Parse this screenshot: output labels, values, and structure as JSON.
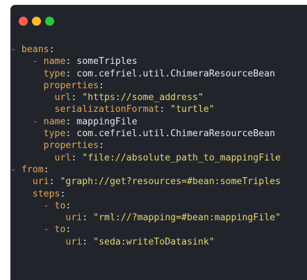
{
  "window": {
    "buttons": [
      {
        "name": "close",
        "color": "#ff5f57"
      },
      {
        "name": "minimize",
        "color": "#febc2e"
      },
      {
        "name": "maximize",
        "color": "#28c840"
      }
    ]
  },
  "colors": {
    "background": "#21252b",
    "dash": "#e06c75",
    "key": "#e5a454",
    "string": "#e8d36e",
    "plain": "#e6e6e6"
  },
  "code_lines": [
    [
      {
        "t": "d",
        "v": "- "
      },
      {
        "t": "k",
        "v": "beans"
      },
      {
        "t": "v",
        "v": ":"
      }
    ],
    [
      {
        "t": "v",
        "v": "    "
      },
      {
        "t": "d",
        "v": "- "
      },
      {
        "t": "k",
        "v": "name"
      },
      {
        "t": "v",
        "v": ": someTriples"
      }
    ],
    [
      {
        "t": "v",
        "v": "      "
      },
      {
        "t": "k",
        "v": "type"
      },
      {
        "t": "v",
        "v": ": com.cefriel.util.ChimeraResourceBean"
      }
    ],
    [
      {
        "t": "v",
        "v": "      "
      },
      {
        "t": "k",
        "v": "properties"
      },
      {
        "t": "v",
        "v": ":"
      }
    ],
    [
      {
        "t": "v",
        "v": "        "
      },
      {
        "t": "k",
        "v": "url"
      },
      {
        "t": "v",
        "v": ": "
      },
      {
        "t": "s",
        "v": "\"https://some_address\""
      }
    ],
    [
      {
        "t": "v",
        "v": "        "
      },
      {
        "t": "k",
        "v": "serializationFormat"
      },
      {
        "t": "v",
        "v": ": "
      },
      {
        "t": "s",
        "v": "\"turtle\""
      }
    ],
    [
      {
        "t": "v",
        "v": "    "
      },
      {
        "t": "d",
        "v": "- "
      },
      {
        "t": "k",
        "v": "name"
      },
      {
        "t": "v",
        "v": ": mappingFile"
      }
    ],
    [
      {
        "t": "v",
        "v": "      "
      },
      {
        "t": "k",
        "v": "type"
      },
      {
        "t": "v",
        "v": ": com.cefriel.util.ChimeraResourceBean"
      }
    ],
    [
      {
        "t": "v",
        "v": "      "
      },
      {
        "t": "k",
        "v": "properties"
      },
      {
        "t": "v",
        "v": ":"
      }
    ],
    [
      {
        "t": "v",
        "v": "        "
      },
      {
        "t": "k",
        "v": "url"
      },
      {
        "t": "v",
        "v": ": "
      },
      {
        "t": "s",
        "v": "\"file://absolute_path_to_mappingFile"
      }
    ],
    [
      {
        "t": "d",
        "v": "- "
      },
      {
        "t": "k",
        "v": "from"
      },
      {
        "t": "v",
        "v": ":"
      }
    ],
    [
      {
        "t": "v",
        "v": "    "
      },
      {
        "t": "k",
        "v": "uri"
      },
      {
        "t": "v",
        "v": ": "
      },
      {
        "t": "s",
        "v": "\"graph://get?resources=#bean:someTriples"
      }
    ],
    [
      {
        "t": "v",
        "v": "    "
      },
      {
        "t": "k",
        "v": "steps"
      },
      {
        "t": "v",
        "v": ":"
      }
    ],
    [
      {
        "t": "v",
        "v": "      "
      },
      {
        "t": "d",
        "v": "- "
      },
      {
        "t": "k",
        "v": "to"
      },
      {
        "t": "v",
        "v": ":"
      }
    ],
    [
      {
        "t": "v",
        "v": "          "
      },
      {
        "t": "k",
        "v": "uri"
      },
      {
        "t": "v",
        "v": ": "
      },
      {
        "t": "s",
        "v": "\"rml://?mapping=#bean:mappingFile\""
      }
    ],
    [
      {
        "t": "v",
        "v": "      "
      },
      {
        "t": "d",
        "v": "- "
      },
      {
        "t": "k",
        "v": "to"
      },
      {
        "t": "v",
        "v": ":"
      }
    ],
    [
      {
        "t": "v",
        "v": "          "
      },
      {
        "t": "k",
        "v": "uri"
      },
      {
        "t": "v",
        "v": ": "
      },
      {
        "t": "s",
        "v": "\"seda:writeToDatasink\""
      }
    ]
  ]
}
